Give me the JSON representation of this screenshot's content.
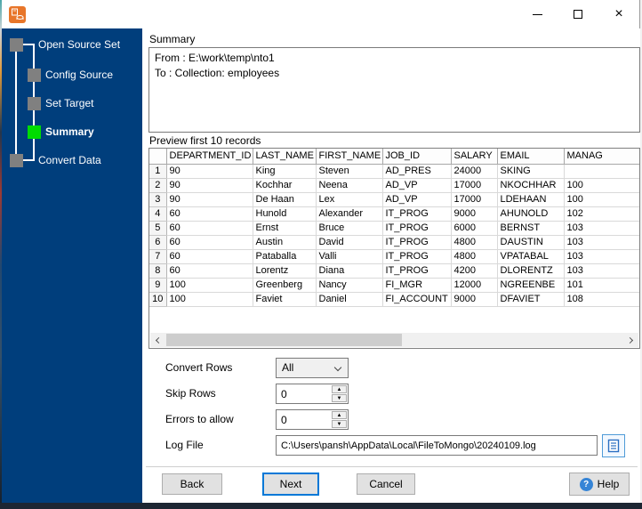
{
  "colors": {
    "sidebar_navy": "#003e7c",
    "active_step_green": "#00dc00",
    "step_gray": "#808080",
    "accent_blue": "#0078d7",
    "app_icon_orange": "#e8762a"
  },
  "titlebar": {
    "title": ""
  },
  "sidebar": {
    "steps": [
      {
        "label": "Open Source Set",
        "state": "normal"
      },
      {
        "label": "Config Source",
        "state": "normal"
      },
      {
        "label": "Set Target",
        "state": "normal"
      },
      {
        "label": "Summary",
        "state": "active"
      },
      {
        "label": "Convert Data",
        "state": "normal"
      }
    ]
  },
  "main": {
    "summary_label": "Summary",
    "summary_lines": [
      "From : E:\\work\\temp\\nto1",
      "To : Collection: employees"
    ],
    "preview_label": "Preview first 10 records",
    "grid": {
      "columns": [
        "",
        "DEPARTMENT_ID",
        "LAST_NAME",
        "FIRST_NAME",
        "JOB_ID",
        "SALARY",
        "EMAIL",
        "MANAG"
      ],
      "rows": [
        [
          "1",
          "90",
          "King",
          "Steven",
          "AD_PRES",
          "24000",
          "SKING",
          ""
        ],
        [
          "2",
          "90",
          "Kochhar",
          "Neena",
          "AD_VP",
          "17000",
          "NKOCHHAR",
          "100"
        ],
        [
          "3",
          "90",
          "De Haan",
          "Lex",
          "AD_VP",
          "17000",
          "LDEHAAN",
          "100"
        ],
        [
          "4",
          "60",
          "Hunold",
          "Alexander",
          "IT_PROG",
          "9000",
          "AHUNOLD",
          "102"
        ],
        [
          "5",
          "60",
          "Ernst",
          "Bruce",
          "IT_PROG",
          "6000",
          "BERNST",
          "103"
        ],
        [
          "6",
          "60",
          "Austin",
          "David",
          "IT_PROG",
          "4800",
          "DAUSTIN",
          "103"
        ],
        [
          "7",
          "60",
          "Pataballa",
          "Valli",
          "IT_PROG",
          "4800",
          "VPATABAL",
          "103"
        ],
        [
          "8",
          "60",
          "Lorentz",
          "Diana",
          "IT_PROG",
          "4200",
          "DLORENTZ",
          "103"
        ],
        [
          "9",
          "100",
          "Greenberg",
          "Nancy",
          "FI_MGR",
          "12000",
          "NGREENBE",
          "101"
        ],
        [
          "10",
          "100",
          "Faviet",
          "Daniel",
          "FI_ACCOUNT",
          "9000",
          "DFAVIET",
          "108"
        ]
      ]
    },
    "form": {
      "convert_rows_label": "Convert Rows",
      "convert_rows_value": "All",
      "skip_rows_label": "Skip Rows",
      "skip_rows_value": "0",
      "errors_label": "Errors to allow",
      "errors_value": "0",
      "log_file_label": "Log File",
      "log_file_value": "C:\\Users\\pansh\\AppData\\Local\\FileToMongo\\20240109.log"
    },
    "buttons": {
      "back": "Back",
      "next": "Next",
      "cancel": "Cancel",
      "help": "Help"
    }
  }
}
